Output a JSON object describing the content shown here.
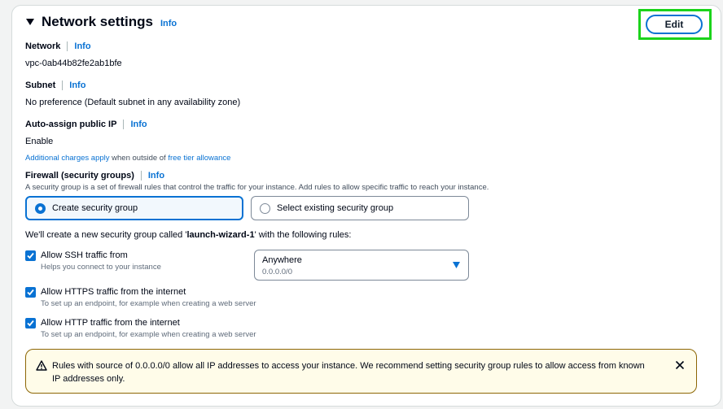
{
  "section": {
    "title": "Network settings",
    "info": "Info",
    "edit_label": "Edit"
  },
  "network": {
    "label": "Network",
    "info": "Info",
    "value": "vpc-0ab44b82fe2ab1bfe"
  },
  "subnet": {
    "label": "Subnet",
    "info": "Info",
    "value": "No preference (Default subnet in any availability zone)"
  },
  "auto_assign": {
    "label": "Auto-assign public IP",
    "info": "Info",
    "value": "Enable",
    "note_link1": "Additional charges apply",
    "note_mid": " when outside of ",
    "note_link2": "free tier allowance"
  },
  "firewall": {
    "label": "Firewall (security groups)",
    "info": "Info",
    "description": "A security group is a set of firewall rules that control the traffic for your instance. Add rules to allow specific traffic to reach your instance.",
    "option_create": "Create security group",
    "option_select": "Select existing security group",
    "selected": "create"
  },
  "rules_intro": {
    "prefix": "We'll create a new security group called '",
    "group_name": "launch-wizard-1",
    "suffix": "' with the following rules:"
  },
  "rules": {
    "ssh": {
      "label": "Allow SSH traffic from",
      "desc": "Helps you connect to your instance",
      "checked": true
    },
    "https": {
      "label": "Allow HTTPS traffic from the internet",
      "desc": "To set up an endpoint, for example when creating a web server",
      "checked": true
    },
    "http": {
      "label": "Allow HTTP traffic from the internet",
      "desc": "To set up an endpoint, for example when creating a web server",
      "checked": true
    }
  },
  "ssh_source": {
    "value": "Anywhere",
    "sub": "0.0.0.0/0"
  },
  "alert": {
    "message": "Rules with source of 0.0.0.0/0 allow all IP addresses to access your instance. We recommend setting security group rules to allow access from known IP addresses only."
  },
  "colors": {
    "accent": "#0972d3",
    "warning_border": "#8d6605",
    "highlight": "#1bd31b"
  },
  "icons": {
    "caret": "caret-down-filled-icon",
    "warning": "warning-icon",
    "close": "close-icon",
    "dropdown": "dropdown-triangle-icon",
    "checkbox": "checkmark-icon"
  }
}
